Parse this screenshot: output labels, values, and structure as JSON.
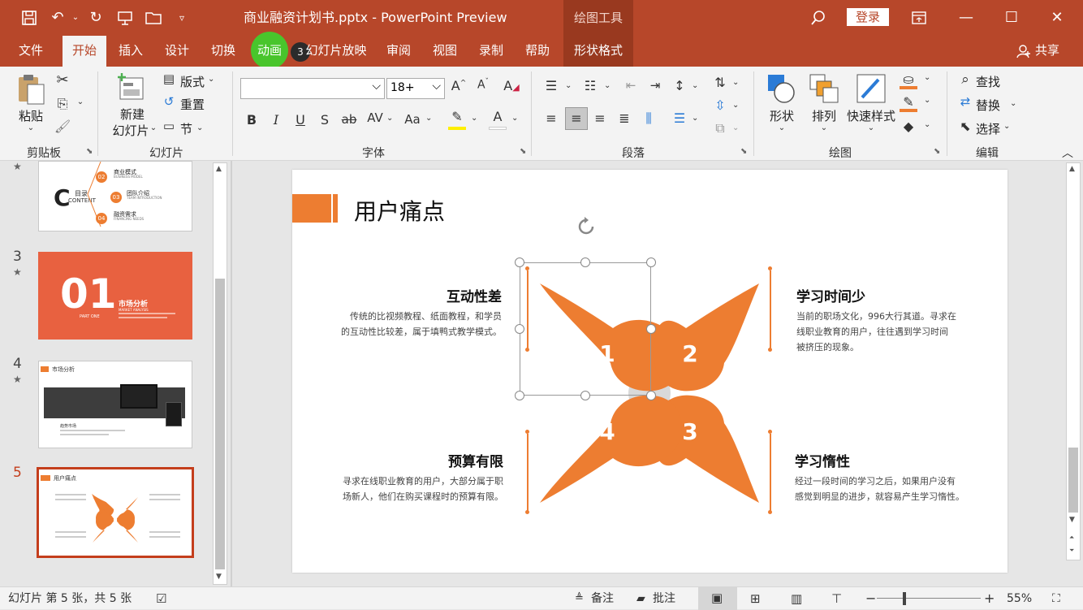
{
  "titlebar": {
    "document_title": "商业融资计划书.pptx  -  PowerPoint Preview",
    "context_group": "绘图工具",
    "login_label": "登录"
  },
  "tabs": {
    "file": "文件",
    "home": "开始",
    "insert": "插入",
    "design": "设计",
    "transitions": "切换",
    "animations": "动画",
    "slideshow": "幻灯片放映",
    "badge": "3",
    "review": "审阅",
    "view": "视图",
    "record": "录制",
    "help": "帮助",
    "shape_format": "形状格式",
    "share": "共享"
  },
  "ribbon": {
    "clipboard": {
      "paste": "粘贴",
      "label": "剪贴板"
    },
    "slides": {
      "new_slide_line1": "新建",
      "new_slide_line2": "幻灯片",
      "layout": "版式",
      "reset": "重置",
      "section": "节",
      "label": "幻灯片"
    },
    "font": {
      "font_name": "",
      "font_size": "18+",
      "label": "字体"
    },
    "paragraph": {
      "label": "段落"
    },
    "drawing": {
      "shapes": "形状",
      "arrange": "排列",
      "quick_styles": "快速样式",
      "label": "绘图"
    },
    "editing": {
      "find": "查找",
      "replace": "替换",
      "select": "选择",
      "label": "编辑"
    }
  },
  "thumbnails": {
    "slide2": {
      "content_title": "目录",
      "content_sub": "CONTENT",
      "items": [
        {
          "num": "02",
          "title": "商业模式",
          "sub": "BUSINESS MODEL"
        },
        {
          "num": "03",
          "title": "团队介绍",
          "sub": "TEAM INTRODUCTION"
        },
        {
          "num": "04",
          "title": "融资需求",
          "sub": "FINANCING NEEDS"
        }
      ]
    },
    "slide3": {
      "num": "3",
      "big": "01",
      "part": "PART ONE",
      "title": "市场分析",
      "sub": "MARKET ANALYSIS"
    },
    "slide4": {
      "num": "4",
      "title": "市场分析",
      "caption": "趋势市场"
    },
    "slide5": {
      "num": "5",
      "title": "用户痛点"
    }
  },
  "slide": {
    "title": "用户痛点",
    "petals": [
      "1",
      "2",
      "3",
      "4"
    ],
    "blocks": {
      "tl": {
        "heading": "互动性差",
        "body_line1": "传统的比视频教程、纸面教程，和学员",
        "body_line2": "的互动性比较差，属于填鸭式教学模式。"
      },
      "tr": {
        "heading": "学习时间少",
        "body_line1": "当前的职场文化，996大行其道。寻求在",
        "body_line2": "线职业教育的用户，往往遇到学习时间",
        "body_line3": "被挤压的现象。"
      },
      "bl": {
        "heading": "预算有限",
        "body_line1": "寻求在线职业教育的用户，大部分属于职",
        "body_line2": "场新人，他们在购买课程时的预算有限。"
      },
      "br": {
        "heading": "学习惰性",
        "body_line1": "经过一段时间的学习之后，如果用户没有",
        "body_line2": "感觉到明显的进步，就容易产生学习惰性。"
      }
    }
  },
  "status": {
    "slide_info": "幻灯片 第 5 张，共 5 张",
    "notes": "备注",
    "comments": "批注",
    "zoom": "55%"
  },
  "colors": {
    "brand": "#b7472a",
    "accent": "#ed7d31",
    "highlight": "#49c52c"
  }
}
